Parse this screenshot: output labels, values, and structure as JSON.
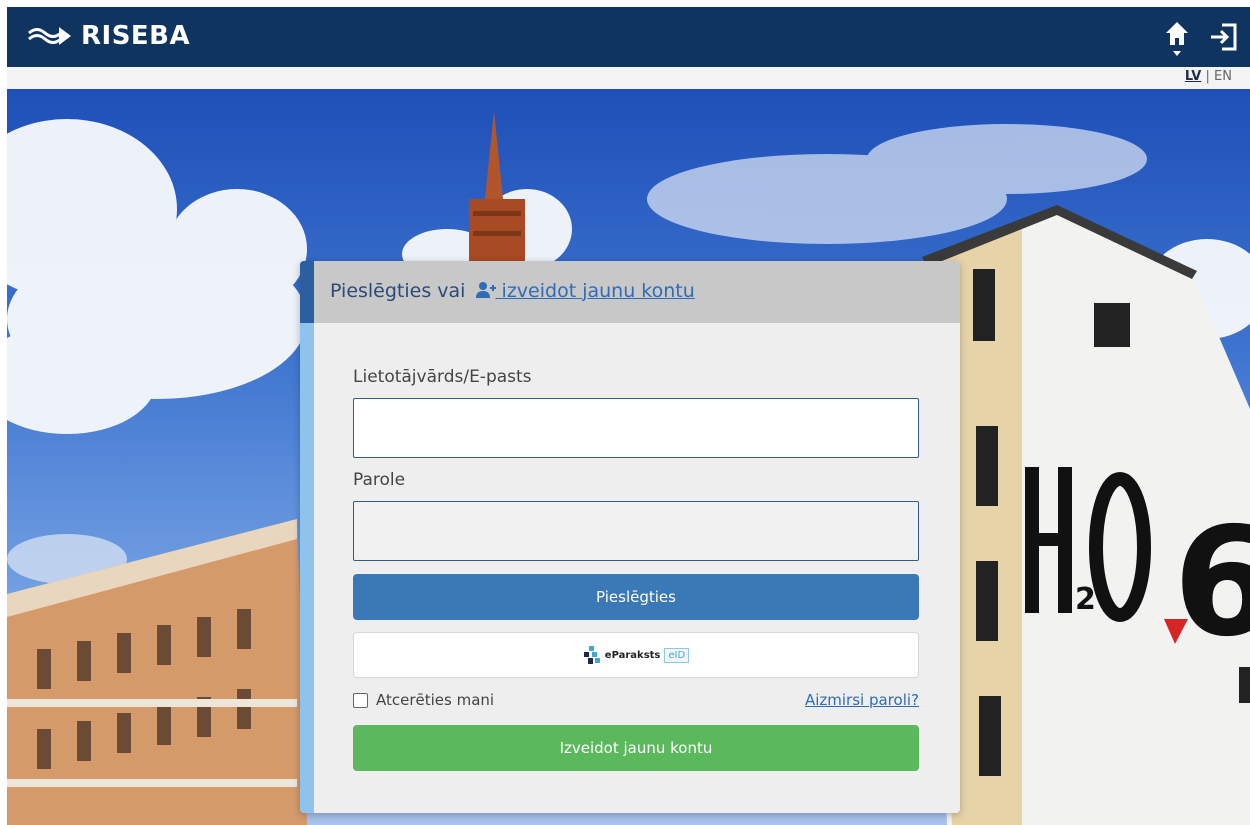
{
  "header": {
    "brand": "RISEBA"
  },
  "language": {
    "lv": "LV",
    "separator": "|",
    "en": "EN"
  },
  "login": {
    "title_prefix": "Pieslēgties vai",
    "title_link_part1": " izveidot",
    "title_link_part2": "jaunu kontu",
    "username_label": "Lietotājvārds/E-pasts",
    "username_value": "",
    "password_label": "Parole",
    "password_value": "",
    "login_button": "Pieslēgties",
    "eparaksts_text": "eParaksts",
    "eparaksts_eid": "eID",
    "remember_label": "Atcerēties mani",
    "forgot_link": "Aizmirsi paroli?",
    "create_button": "Izveidot jaunu kontu"
  },
  "icons": {
    "logo": "riseba-wave-icon",
    "home": "home-icon",
    "logout": "sign-in-icon",
    "add_user": "add-user-icon"
  },
  "colors": {
    "topbar": "#0f3460",
    "primary_button": "#3a78b6",
    "create_button": "#5cb85c",
    "link": "#2f6cb8"
  }
}
